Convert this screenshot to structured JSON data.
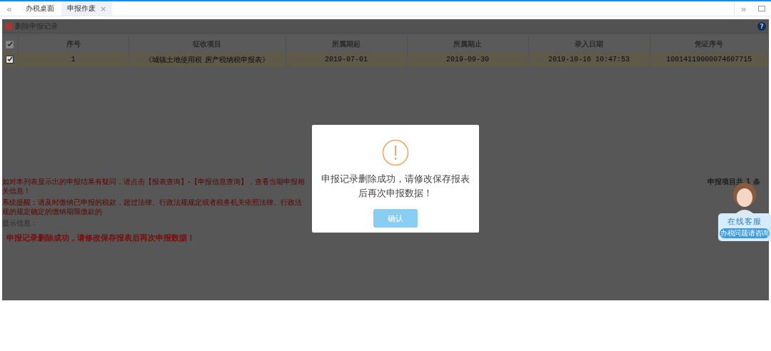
{
  "tabs": [
    {
      "label": "办税桌面",
      "selected": false,
      "closable": false
    },
    {
      "label": "申报作废",
      "selected": true,
      "closable": true,
      "close": "×"
    }
  ],
  "nav": {
    "prev": "«",
    "next": "»"
  },
  "panel": {
    "title": "删除申报记录",
    "help": "?"
  },
  "table": {
    "select_all": {
      "checked": true
    },
    "columns": [
      "序号",
      "征收项目",
      "所属期起",
      "所属期止",
      "录入日期",
      "凭证序号"
    ],
    "rows": [
      {
        "selected": true,
        "checked": true,
        "cells": [
          "1",
          "《城镇土地使用税 房产税纳税申报表》",
          "2019-07-01",
          "2019-09-30",
          "2019-10-16 10:47:53",
          "10014119000074607715"
        ]
      }
    ]
  },
  "notices": [
    {
      "text": "如对本列表显示出的申报结果有疑问，请点击【报表查询】-【申报信息查询】，查看当期申报相关信息！"
    },
    {
      "text": "系统提醒：请及时缴纳已申报的税款，超过法律、行政法规规定或者税务机关依照法律、行政法规的规定确定的缴纳期限缴款的"
    }
  ],
  "count": "申报项目共 1 条",
  "hint_label": "提示信息：",
  "hint_message": "申报记录删除成功，请修改保存报表后再次申报数据！",
  "dialog": {
    "message": "申报记录删除成功，请修改保存报表后再次申报数据！",
    "confirm": "确认"
  },
  "service": {
    "title": "在线客服",
    "subtitle": "办税问题请咨询"
  }
}
